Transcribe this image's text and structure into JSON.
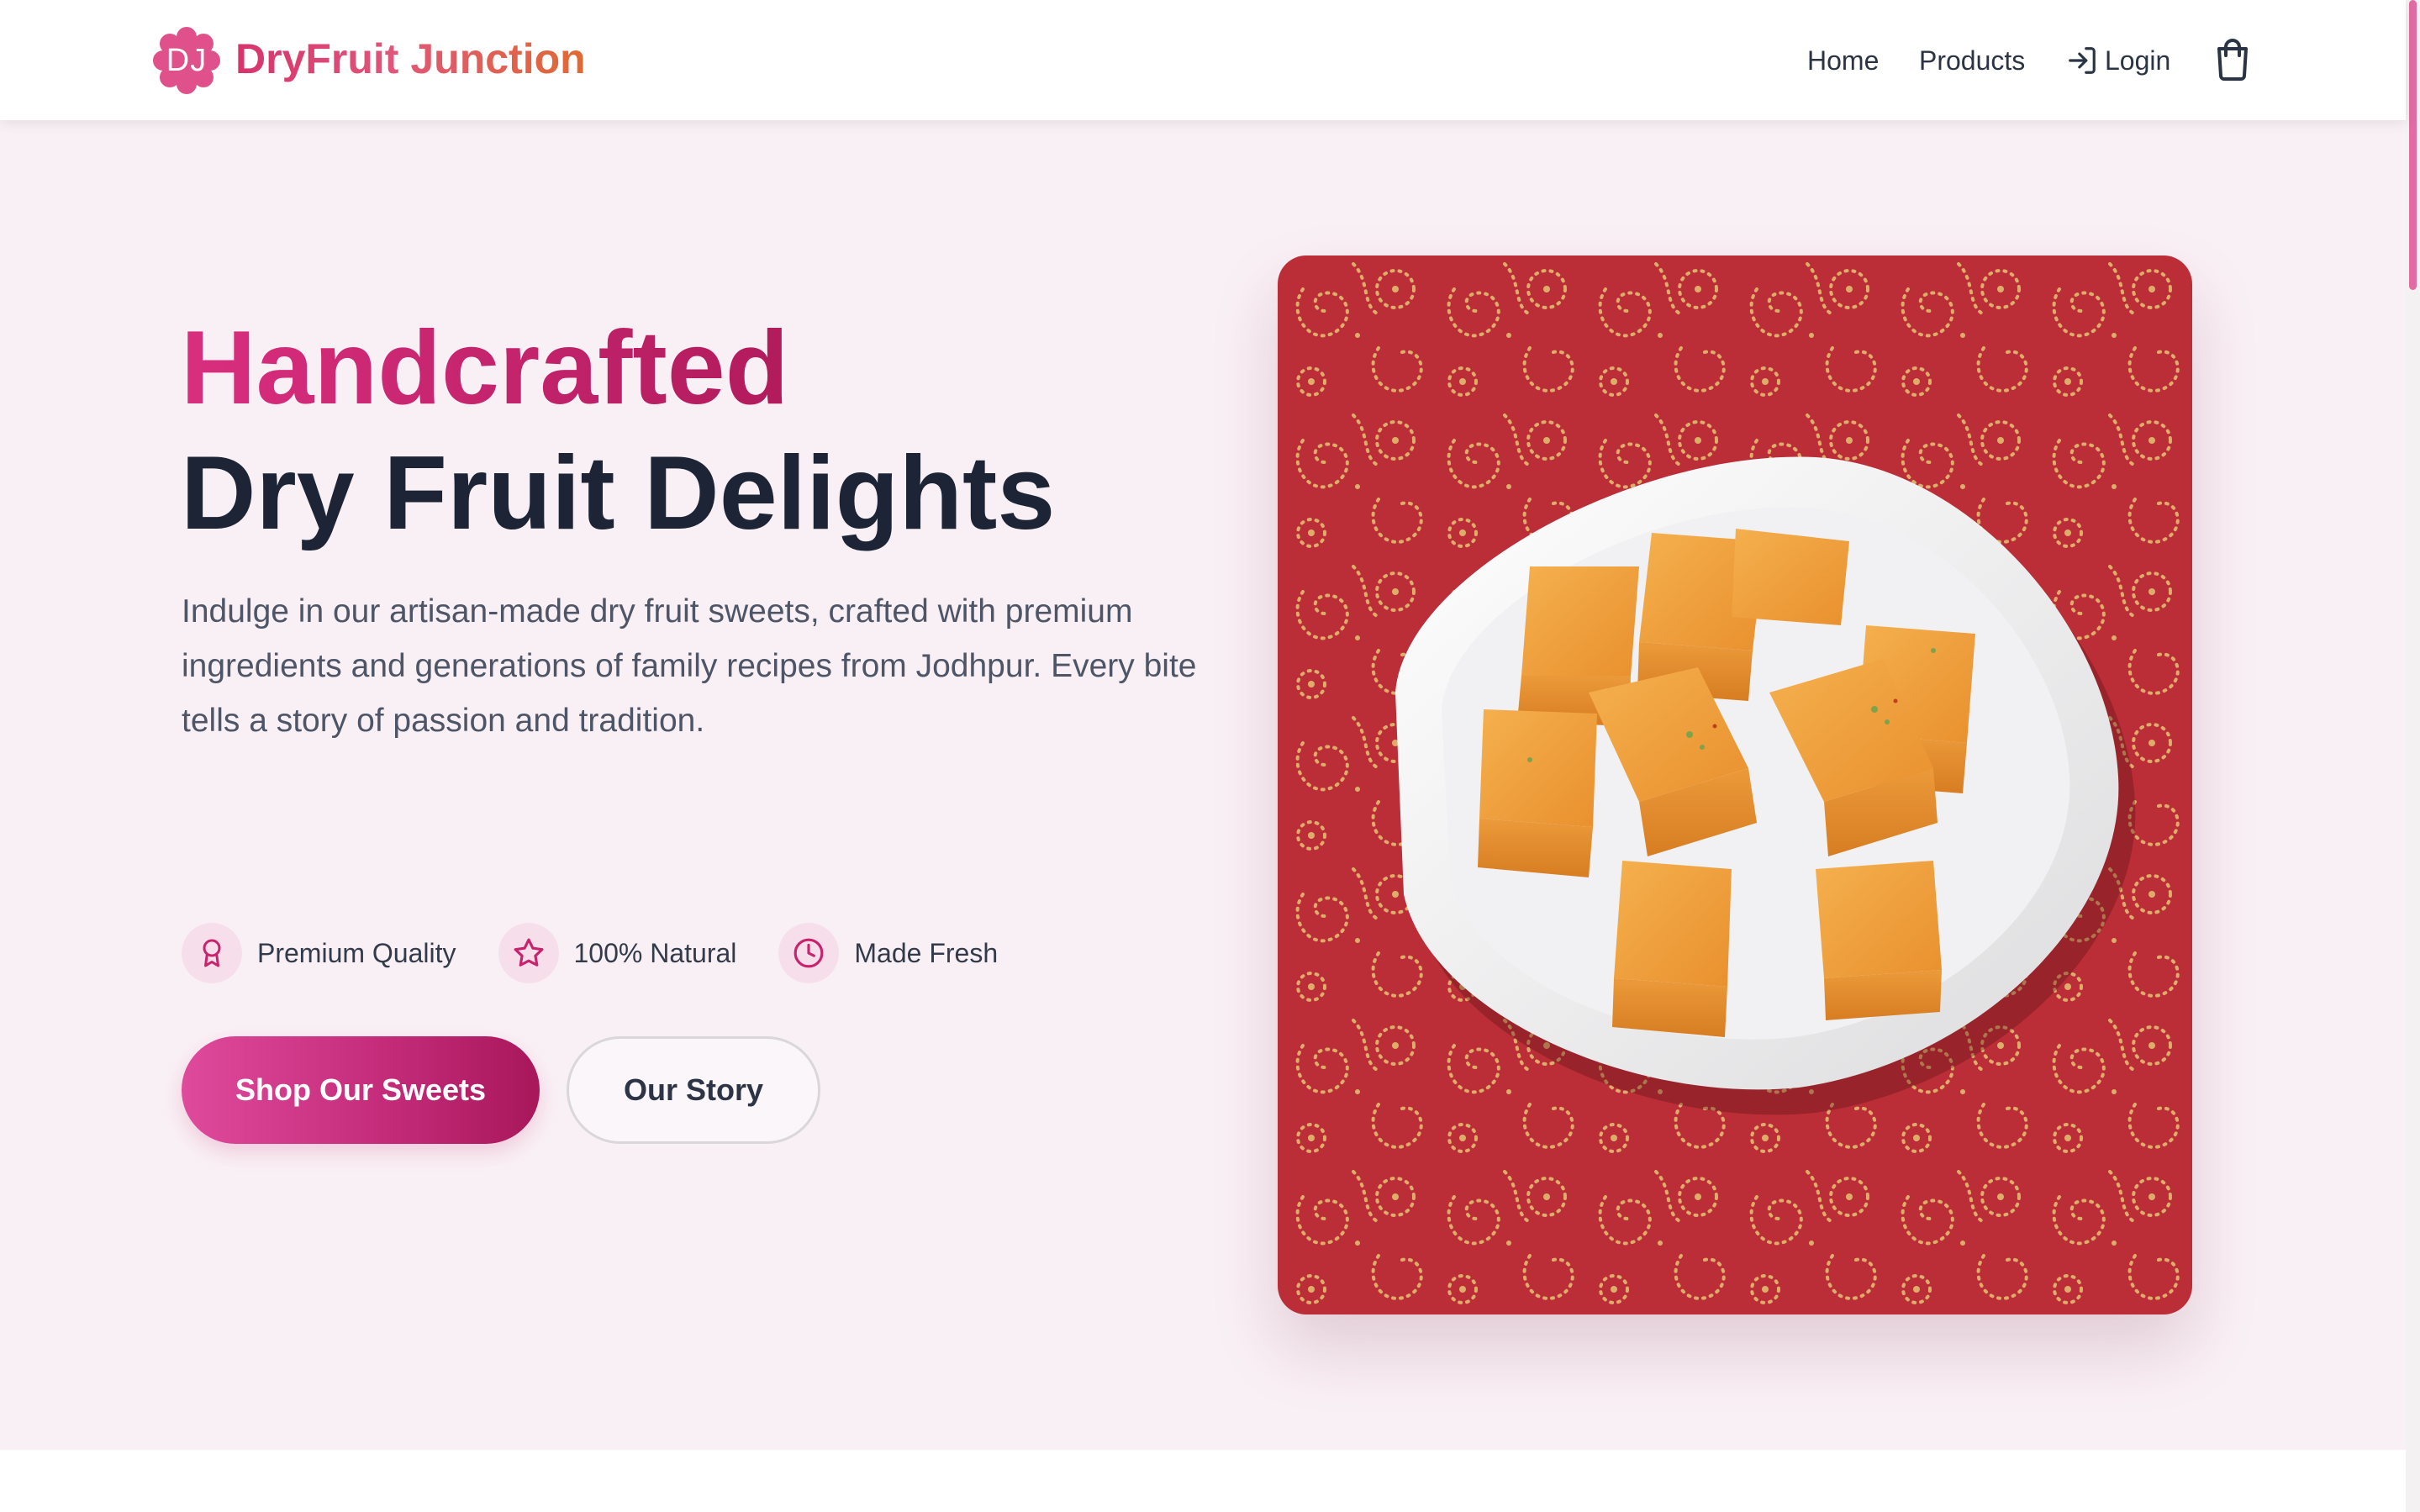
{
  "header": {
    "logo_text": "DJ",
    "brand_name": "DryFruit Junction",
    "nav": {
      "home": "Home",
      "products": "Products",
      "login": "Login"
    },
    "cart_icon": "shopping-bag-icon"
  },
  "hero": {
    "title_line_1": "Handcrafted",
    "title_line_2": "Dry Fruit Delights",
    "description": "Indulge in our artisan-made dry fruit sweets, crafted with premium ingredients and generations of family recipes from Jodhpur. Every bite tells a story of passion and tradition.",
    "features": [
      {
        "icon": "award-ribbon-icon",
        "label": "Premium Quality"
      },
      {
        "icon": "star-icon",
        "label": "100% Natural"
      },
      {
        "icon": "clock-icon",
        "label": "Made Fresh"
      }
    ],
    "primary_button": "Shop Our Sweets",
    "secondary_button": "Our Story",
    "image_subject": "plate of orange dry fruit sweet squares on red paisley cloth"
  },
  "colors": {
    "brand_pink": "#d6336c",
    "brand_orange": "#e06a32",
    "hero_background": "#f9f0f5",
    "heading_dark": "#1c2436",
    "accent_magenta": "#c22a78"
  }
}
